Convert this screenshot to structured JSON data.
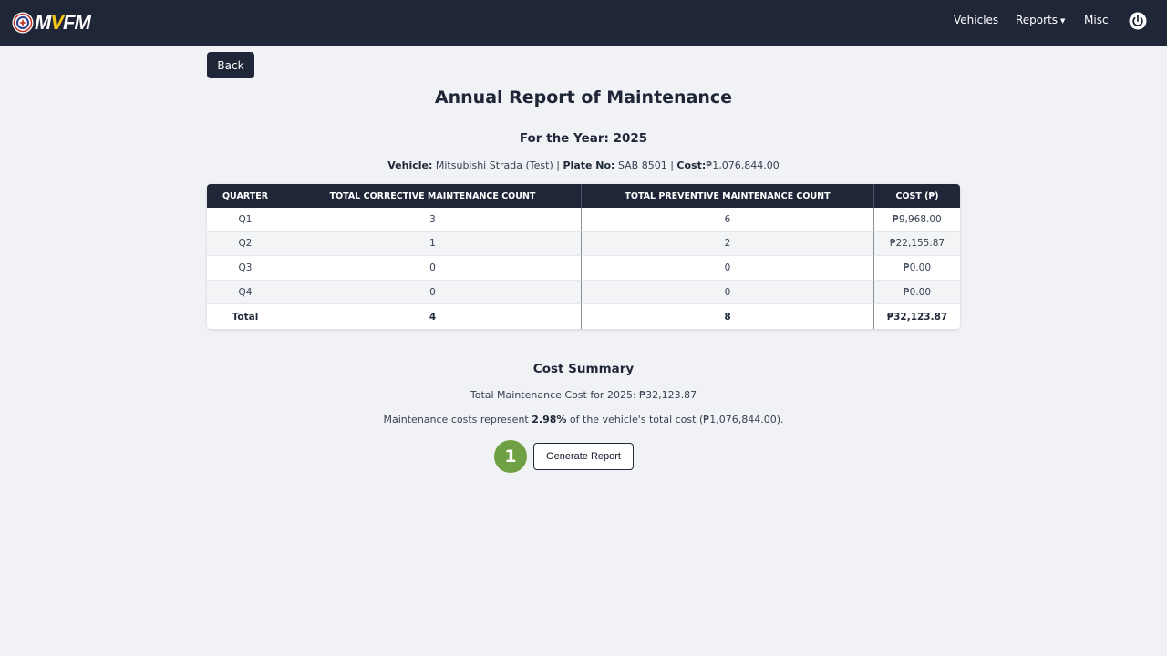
{
  "brand": {
    "logo_prefix": "M",
    "logo_accent": "V",
    "logo_suffix": "FM"
  },
  "nav": {
    "vehicles": "Vehicles",
    "reports": "Reports",
    "reports_caret": "▼",
    "misc": "Misc",
    "power_icon": "power-icon"
  },
  "back_label": "Back",
  "title": "Annual Report of Maintenance",
  "subtitle": "For the Year: 2025",
  "vehicle_info": {
    "vehicle_label": "Vehicle:",
    "vehicle_value": "Mitsubishi Strada (Test)",
    "sep1": "|",
    "plate_label": "Plate No:",
    "plate_value": "SAB 8501",
    "sep2": "|",
    "cost_label": "Cost:",
    "cost_value": "₱1,076,844.00"
  },
  "table": {
    "headers": [
      "QUARTER",
      "TOTAL CORRECTIVE MAINTENANCE COUNT",
      "TOTAL PREVENTIVE MAINTENANCE COUNT",
      "COST (₱)"
    ],
    "rows": [
      [
        "Q1",
        "3",
        "6",
        "₱9,968.00"
      ],
      [
        "Q2",
        "1",
        "2",
        "₱22,155.87"
      ],
      [
        "Q3",
        "0",
        "0",
        "₱0.00"
      ],
      [
        "Q4",
        "0",
        "0",
        "₱0.00"
      ]
    ],
    "total": [
      "Total",
      "4",
      "8",
      "₱32,123.87"
    ]
  },
  "cost_summary": {
    "heading": "Cost Summary",
    "line1": "Total Maintenance Cost for 2025: ₱32,123.87",
    "line2_prefix": "Maintenance costs represent",
    "line2_percent": "2.98%",
    "line2_suffix": "of the vehicle's total cost (₱1,076,844.00)."
  },
  "step_marker": "1",
  "generate_label": "Generate Report",
  "colors": {
    "navbar": "#1e2638",
    "accent": "#f5c518",
    "marker": "#6fa044"
  }
}
